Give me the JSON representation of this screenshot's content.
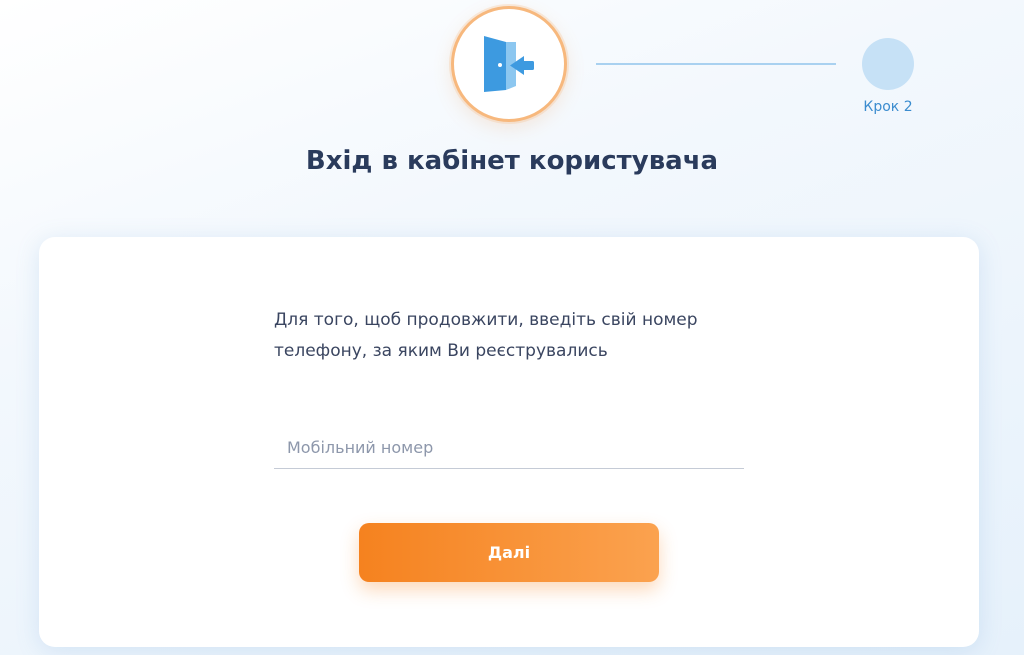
{
  "stepper": {
    "step1_icon": "door-enter-icon",
    "step2_label": "Крок 2"
  },
  "header": {
    "title": "Вхід в кабінет користувача"
  },
  "form": {
    "instructions": "Для того, щоб продовжити, введіть свій номер телефону, за яким Ви реєструвались",
    "phone_placeholder": "Мобільний номер",
    "phone_value": "",
    "next_label": "Далі"
  },
  "colors": {
    "accent_orange": "#f5821f",
    "step_ring": "#f7b87d",
    "door_blue": "#3d9ae0",
    "step_inactive": "#c6e1f6",
    "title_text": "#2a3b5c",
    "step_label_text": "#3b8ccf"
  }
}
